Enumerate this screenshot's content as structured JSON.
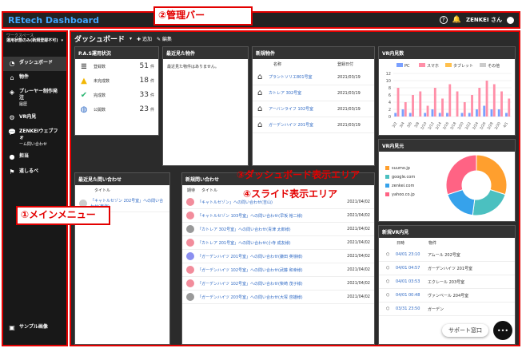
{
  "topbar": {
    "brand": "REtech Dashboard",
    "user": "ZENKEI さん"
  },
  "callouts": {
    "admin_bar": "②管理バー",
    "dashboard_area": "③ダッシュボード表示エリア",
    "slide_area": "④スライド表示エリア",
    "main_menu": "①メインメニュー"
  },
  "sidebar": {
    "workspace_label": "ワークスペース",
    "workspace_value": "運用状態のみ(新規登録不可)",
    "items": [
      {
        "label": "ダッシュボード",
        "sub": ""
      },
      {
        "label": "物件",
        "sub": ""
      },
      {
        "label": "プレーヤー制作発注",
        "sub": "履歴"
      },
      {
        "label": "VR内見",
        "sub": ""
      },
      {
        "label": "ZENKEIウェブフォ",
        "sub": "ーム問い合わせ"
      },
      {
        "label": "担当",
        "sub": ""
      },
      {
        "label": "道しるべ",
        "sub": ""
      }
    ],
    "bottom_item": "サンプル画像"
  },
  "header": {
    "title": "ダッシュボード",
    "add": "追加",
    "edit": "編集"
  },
  "pas": {
    "title": "P.A.S運用状況",
    "rows": [
      {
        "label": "登録数",
        "value": "51",
        "unit": "件",
        "color": "#222222"
      },
      {
        "label": "未完成数",
        "value": "18",
        "unit": "件",
        "color": "#f2b705"
      },
      {
        "label": "完成数",
        "value": "33",
        "unit": "件",
        "color": "#2bb673"
      },
      {
        "label": "公開数",
        "value": "23",
        "unit": "件",
        "color": "#2d68c4"
      }
    ]
  },
  "recent_viewed": {
    "title": "最近見た物件",
    "empty": "最近見た物件はありません。"
  },
  "new_props": {
    "title": "新規物件",
    "col_name": "名称",
    "col_date": "登録日付",
    "rows": [
      {
        "name": "プラントソリエ801号室",
        "date": "2021/03/19"
      },
      {
        "name": "カトレア 302号室",
        "date": "2021/03/19"
      },
      {
        "name": "アーバンライフ 102号室",
        "date": "2021/03/19"
      },
      {
        "name": "ガーデンハイツ 201号室",
        "date": "2021/03/19"
      }
    ]
  },
  "vr_count": {
    "title": "VR内見数",
    "chart_data": {
      "type": "bar",
      "categories": [
        "3/2",
        "3/4",
        "3/6",
        "3/8",
        "3/10",
        "3/12",
        "3/14",
        "3/16",
        "3/18",
        "3/20",
        "3/22",
        "3/24",
        "3/26",
        "3/28",
        "3/30",
        "4/1"
      ],
      "series": [
        {
          "name": "PC",
          "values": [
            1,
            2,
            1,
            0,
            1,
            2,
            1,
            1,
            0,
            1,
            1,
            2,
            3,
            2,
            2,
            1
          ],
          "color": "#7aa0ff"
        },
        {
          "name": "スマホ",
          "values": [
            8,
            4,
            6,
            7,
            3,
            8,
            5,
            9,
            7,
            4,
            6,
            8,
            10,
            9,
            7,
            5
          ],
          "color": "#ff8fa8"
        },
        {
          "name": "タブレット",
          "values": [
            0,
            0,
            0,
            0,
            0,
            0,
            0,
            0,
            0,
            0,
            0,
            0,
            0,
            0,
            0,
            0
          ],
          "color": "#ffc04d"
        },
        {
          "name": "その他",
          "values": [
            0,
            0,
            0,
            0,
            0,
            0,
            0,
            0,
            0,
            0,
            0,
            0,
            0,
            0,
            0,
            0
          ],
          "color": "#cccccc"
        }
      ],
      "ylim": [
        0,
        12
      ],
      "yticks": [
        "0",
        "2",
        "4",
        "6",
        "8",
        "10",
        "12"
      ]
    }
  },
  "vr_sources": {
    "title": "VR内見元",
    "chart_data": {
      "type": "pie",
      "labels": [
        "suumo.jp",
        "google.com",
        "zenkei.com",
        "yahoo.co.jp"
      ],
      "values": [
        30,
        22,
        18,
        30
      ],
      "colors": [
        "#ff9f2e",
        "#4bc0c0",
        "#36a2eb",
        "#ff6384"
      ]
    }
  },
  "recent_inq": {
    "title": "最近見た問い合わせ",
    "col_title": "タイトル",
    "row": "「キャトルセゾン 202号室」への問い合わせ(東海)"
  },
  "new_inq": {
    "title": "新規問い合わせ",
    "col_date": "期待",
    "col_title": "タイトル",
    "rows": [
      {
        "text": "「キャトルセゾン」への問い合わせ(吉山)",
        "date": "2021/04/02",
        "mood": "pink"
      },
      {
        "text": "「キャトルセゾン 103号室」への問い合わせ(早坂 裕二様)",
        "date": "2021/04/02",
        "mood": "pink"
      },
      {
        "text": "「カトレア 302号室」への問い合わせ(青津 太郎様)",
        "date": "2021/04/02",
        "mood": "gray"
      },
      {
        "text": "「カトレア 201号室」への問い合わせ(小寺 成友様)",
        "date": "2021/04/02",
        "mood": "pink"
      },
      {
        "text": "「ガーデンハイツ 201号室」への問い合わせ(鎌田 英嶺様)",
        "date": "2021/04/02",
        "mood": "blue"
      },
      {
        "text": "「ガーデンハイツ 102号室」への問い合わせ(武藤 和幸様)",
        "date": "2021/04/02",
        "mood": "pink"
      },
      {
        "text": "「ガーデンハイツ 102号室」への問い合わせ(柴崎 茂子様)",
        "date": "2021/04/02",
        "mood": "pink"
      },
      {
        "text": "「ガーデンハイツ 203号室」への問い合わせ(大塚 啓雄様)",
        "date": "2021/04/02",
        "mood": "gray"
      }
    ]
  },
  "new_vr": {
    "title": "新規VR内見",
    "col_date": "日時",
    "col_prop": "物件",
    "rows": [
      {
        "date": "04/01 23:10",
        "prop": "アムール 202号室"
      },
      {
        "date": "04/01 04:57",
        "prop": "ガーデンハイツ 201号室"
      },
      {
        "date": "04/01 03:53",
        "prop": "エクレール 203号室"
      },
      {
        "date": "04/01 00:48",
        "prop": "ヴァンベール 204号室"
      },
      {
        "date": "03/31 23:50",
        "prop": "ガーデン"
      }
    ]
  },
  "support": {
    "label": "サポート窓口"
  }
}
